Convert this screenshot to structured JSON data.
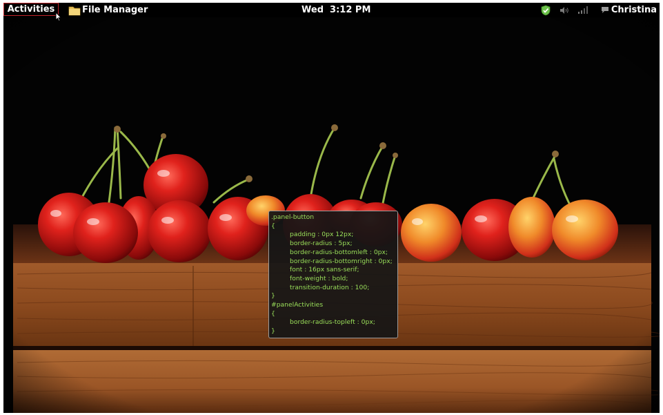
{
  "top_panel": {
    "activities_label": "Activities",
    "app_menu_label": "File Manager",
    "app_icon": "folder-icon",
    "clock_label": "Wed  3:12 PM",
    "user_name": "Christina",
    "status_icons": [
      "update-shield-icon",
      "volume-icon",
      "network-signal-icon",
      "chat-bubble-icon"
    ]
  },
  "desktop": {
    "wallpaper": "cherries-on-wooden-board"
  },
  "css_popup": {
    "lines": [
      {
        "text": ".panel-button",
        "indent": false
      },
      {
        "text": "{",
        "indent": false
      },
      {
        "text": "padding : 0px 12px;",
        "indent": true
      },
      {
        "text": "border-radius : 5px;",
        "indent": true
      },
      {
        "text": "border-radius-bottomleft : 0px;",
        "indent": true
      },
      {
        "text": "border-radius-bottomright : 0px;",
        "indent": true
      },
      {
        "text": "font : 16px sans-serif;",
        "indent": true
      },
      {
        "text": "font-weight : bold;",
        "indent": true
      },
      {
        "text": "transition-duration : 100;",
        "indent": true
      },
      {
        "text": "}",
        "indent": false
      },
      {
        "text": "#panelActivities",
        "indent": false
      },
      {
        "text": "{",
        "indent": false
      },
      {
        "text": "border-radius-topleft : 0px;",
        "indent": true
      },
      {
        "text": "}",
        "indent": false
      }
    ]
  },
  "colors": {
    "panel_bg": "#000000",
    "code_text": "#9adf5a",
    "activities_border": "#c0242b"
  }
}
